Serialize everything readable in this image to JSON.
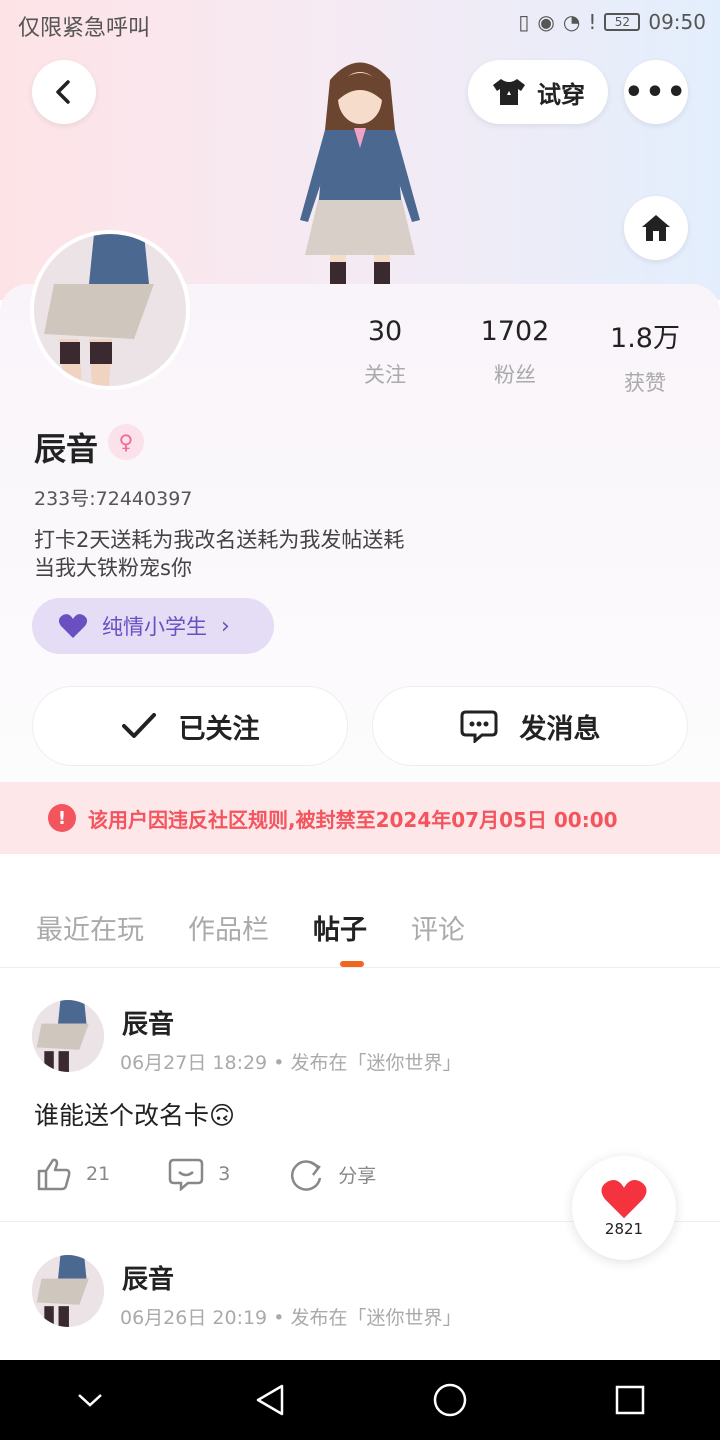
{
  "status_bar": {
    "carrier": "仅限紧急呼叫",
    "battery": "52",
    "time": "09:50"
  },
  "header": {
    "try_on_label": "试穿"
  },
  "profile": {
    "name": "辰音",
    "uid": "233号:72440397",
    "bio_line1": "打卡2天送耗为我改名送耗为我发帖送耗",
    "bio_line2": "当我大铁粉宠s你",
    "title_badge": "纯情小学生",
    "stats": [
      {
        "value": "30",
        "label": "关注"
      },
      {
        "value": "1702",
        "label": "粉丝"
      },
      {
        "value": "1.8万",
        "label": "获赞"
      }
    ]
  },
  "actions": {
    "followed_label": "已关注",
    "message_label": "发消息"
  },
  "ban_notice": "该用户因违反社区规则,被封禁至2024年07月05日 00:00",
  "tabs": [
    {
      "label": "最近在玩",
      "active": false
    },
    {
      "label": "作品栏",
      "active": false
    },
    {
      "label": "帖子",
      "active": true
    },
    {
      "label": "评论",
      "active": false
    }
  ],
  "posts": [
    {
      "author": "辰音",
      "date": "06月27日 18:29",
      "location": "发布在「迷你世界」",
      "text": "谁能送个改名卡🙃",
      "likes": "21",
      "comments": "3",
      "share": "分享"
    },
    {
      "author": "辰音",
      "date": "06月26日 20:19",
      "location": "发布在「迷你世界」"
    }
  ],
  "like_fab": {
    "count": "2821"
  }
}
